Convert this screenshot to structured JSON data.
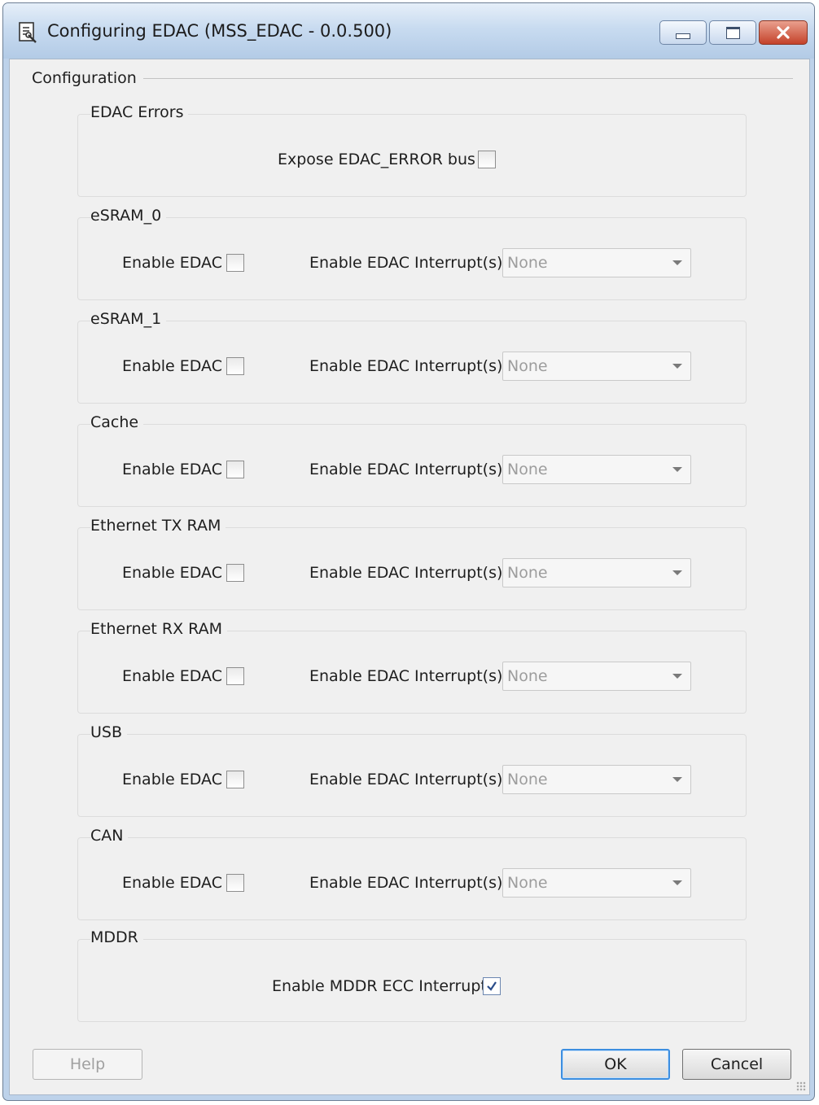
{
  "window": {
    "title": "Configuring EDAC (MSS_EDAC - 0.0.500)",
    "app_icon": "edac-config-icon",
    "controls": [
      "minimize-icon",
      "maximize-icon",
      "close-icon"
    ]
  },
  "configuration": {
    "label": "Configuration"
  },
  "edac_errors": {
    "title": "EDAC Errors",
    "expose_label": "Expose EDAC_ERROR bus",
    "expose_checked": false
  },
  "sections": [
    {
      "title": "eSRAM_0",
      "enable_label": "Enable EDAC",
      "enable_checked": false,
      "interrupt_label": "Enable EDAC Interrupt(s)",
      "interrupt_value": "None"
    },
    {
      "title": "eSRAM_1",
      "enable_label": "Enable EDAC",
      "enable_checked": false,
      "interrupt_label": "Enable EDAC Interrupt(s)",
      "interrupt_value": "None"
    },
    {
      "title": "Cache",
      "enable_label": "Enable EDAC",
      "enable_checked": false,
      "interrupt_label": "Enable EDAC Interrupt(s)",
      "interrupt_value": "None"
    },
    {
      "title": "Ethernet TX RAM",
      "enable_label": "Enable EDAC",
      "enable_checked": false,
      "interrupt_label": "Enable EDAC Interrupt(s)",
      "interrupt_value": "None"
    },
    {
      "title": "Ethernet RX RAM",
      "enable_label": "Enable EDAC",
      "enable_checked": false,
      "interrupt_label": "Enable EDAC Interrupt(s)",
      "interrupt_value": "None"
    },
    {
      "title": "USB",
      "enable_label": "Enable EDAC",
      "enable_checked": false,
      "interrupt_label": "Enable EDAC Interrupt(s)",
      "interrupt_value": "None"
    },
    {
      "title": "CAN",
      "enable_label": "Enable EDAC",
      "enable_checked": false,
      "interrupt_label": "Enable EDAC Interrupt(s)",
      "interrupt_value": "None"
    }
  ],
  "mddr": {
    "title": "MDDR",
    "ecc_label": "Enable MDDR ECC Interrupt",
    "ecc_checked": true
  },
  "buttons": {
    "help": "Help",
    "ok": "OK",
    "cancel": "Cancel"
  },
  "colors": {
    "accent": "#3d8ee0",
    "close_button": "#c4422a",
    "titlebar": "#c8dbf0"
  }
}
